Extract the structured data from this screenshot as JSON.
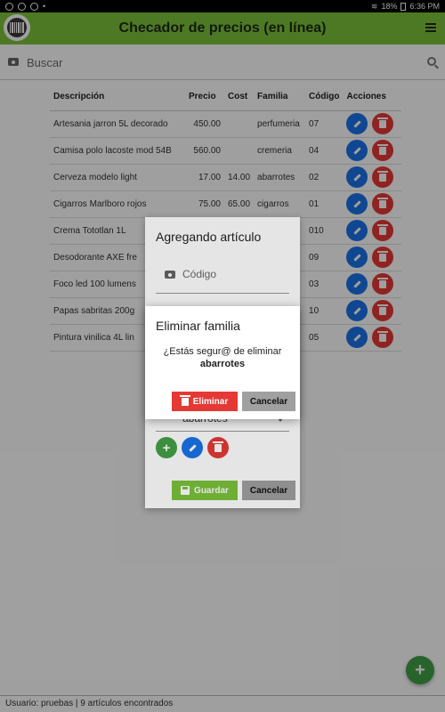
{
  "statusbar": {
    "battery": "18%",
    "time": "6:36 PM"
  },
  "app": {
    "title": "Checador de precios (en línea)"
  },
  "search": {
    "placeholder": "Buscar"
  },
  "table": {
    "headers": [
      "Descripción",
      "Precio",
      "Cost",
      "Familia",
      "Código",
      "Acciones"
    ],
    "rows": [
      [
        "Artesania jarron 5L decorado",
        "450.00",
        "",
        "perfumeria",
        "07"
      ],
      [
        "Camisa polo lacoste mod 54B",
        "560.00",
        "",
        "cremeria",
        "04"
      ],
      [
        "Cerveza modelo light",
        "17.00",
        "14.00",
        "abarrotes",
        "02"
      ],
      [
        "Cigarros Marlboro rojos",
        "75.00",
        "65.00",
        "cigarros",
        "01"
      ],
      [
        "Crema Tototlan 1L",
        "",
        "",
        "",
        "010"
      ],
      [
        "Desodorante AXE fre",
        "",
        "",
        "",
        "09"
      ],
      [
        "Foco led 100 lumens",
        "",
        "",
        "",
        "03"
      ],
      [
        "Papas sabritas 200g",
        "",
        "",
        "",
        "10"
      ],
      [
        "Pintura vinilica 4L lin",
        "",
        "",
        "",
        "05"
      ]
    ]
  },
  "dialog_article": {
    "title": "Agregando artículo",
    "code_placeholder": "Código",
    "family_value": "abarrotes",
    "save_label": "Guardar",
    "cancel_label": "Cancelar"
  },
  "dialog_delete": {
    "title": "Eliminar familia",
    "message": "¿Estás segur@ de eliminar",
    "target": "abarrotes",
    "delete_label": "Eliminar",
    "cancel_label": "Cancelar"
  },
  "footer": {
    "text": "Usuario: pruebas  |  9 artículos encontrados"
  },
  "colors": {
    "appbar": "#7cc23b",
    "edit": "#1a73e8",
    "delete": "#e53935",
    "add": "#43a047"
  }
}
